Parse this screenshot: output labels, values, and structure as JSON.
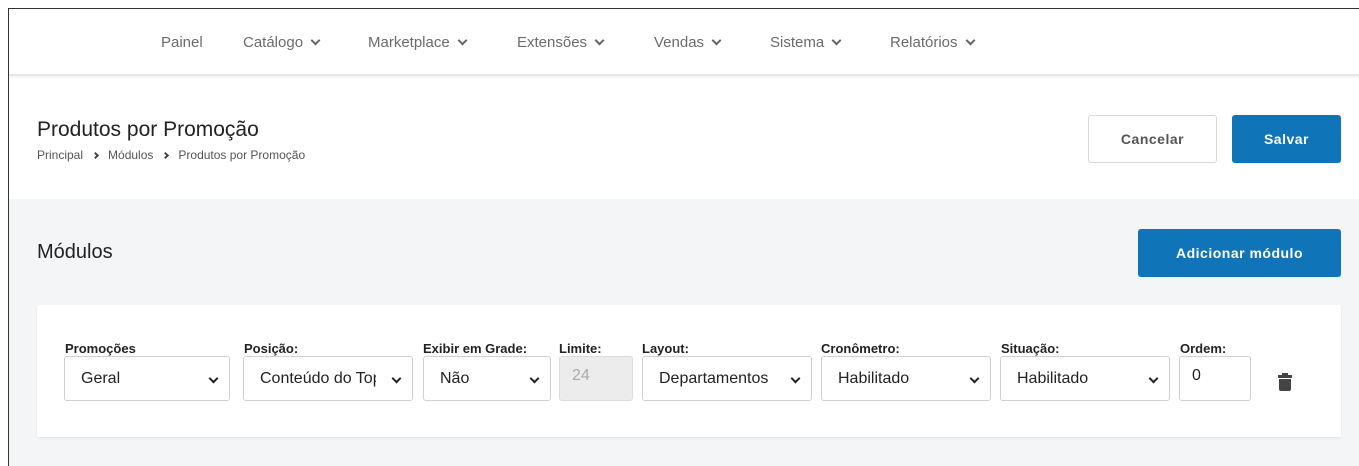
{
  "nav": {
    "items": [
      {
        "label": "Painel",
        "dropdown": false
      },
      {
        "label": "Catálogo",
        "dropdown": true
      },
      {
        "label": "Marketplace",
        "dropdown": true
      },
      {
        "label": "Extensões",
        "dropdown": true
      },
      {
        "label": "Vendas",
        "dropdown": true
      },
      {
        "label": "Sistema",
        "dropdown": true
      },
      {
        "label": "Relatórios",
        "dropdown": true
      }
    ]
  },
  "header": {
    "title": "Produtos por Promoção",
    "breadcrumb": [
      "Principal",
      "Módulos",
      "Produtos por Promoção"
    ],
    "cancel_label": "Cancelar",
    "save_label": "Salvar"
  },
  "modules": {
    "title": "Módulos",
    "add_label": "Adicionar módulo",
    "fields": {
      "promocoes": {
        "label": "Promoções",
        "value": "Geral"
      },
      "posicao": {
        "label": "Posição:",
        "value": "Conteúdo do Topo"
      },
      "exibir_grade": {
        "label": "Exibir em Grade:",
        "value": "Não"
      },
      "limite": {
        "label": "Limite:",
        "value": "24"
      },
      "layout": {
        "label": "Layout:",
        "value": "Departamentos"
      },
      "cronometro": {
        "label": "Cronômetro:",
        "value": "Habilitado"
      },
      "situacao": {
        "label": "Situação:",
        "value": "Habilitado"
      },
      "ordem": {
        "label": "Ordem:",
        "value": "0"
      }
    }
  },
  "colors": {
    "primary": "#1074b8",
    "background": "#f4f5f7"
  },
  "icons": {
    "delete": "trash-icon",
    "dropdown": "chevron-down-icon",
    "breadcrumb_sep": "chevron-right-icon"
  }
}
